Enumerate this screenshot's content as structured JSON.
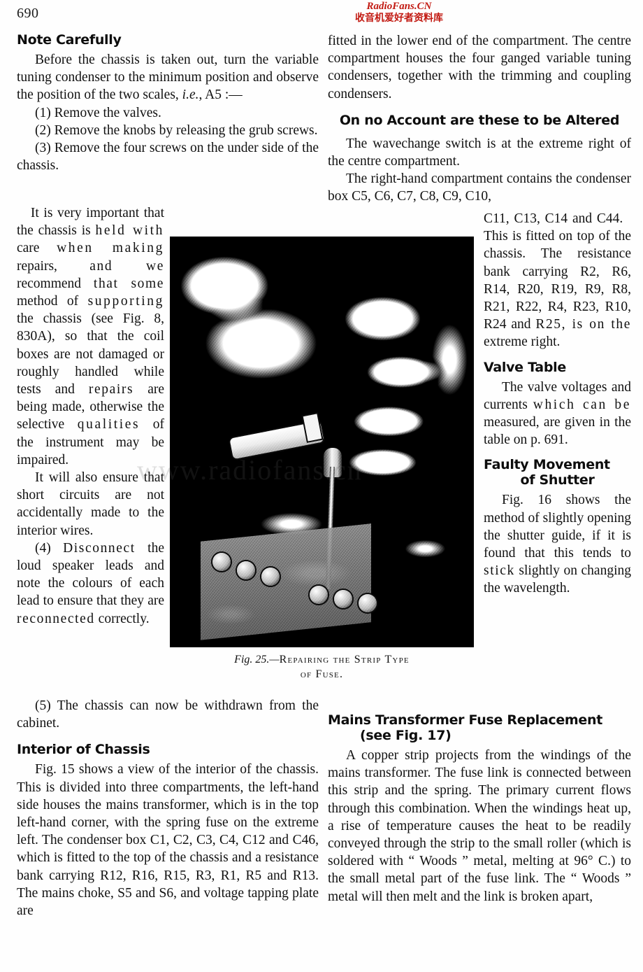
{
  "page": {
    "folio": "690"
  },
  "watermark": {
    "english": "RadioFans.CN",
    "chinese": "收音机爱好者资料库",
    "ghost": "www.radiofans.cn",
    "color": "#c21a12"
  },
  "left_column": {
    "heading_note": "Note Carefully",
    "para_before": "Before the chassis is taken out, turn the variable tuning condenser to the minimum position and observe the position of the two scales, i.e., A5 :—",
    "para_before_italic": "i.e.",
    "step_1": "(1) Remove the valves.",
    "step_2": "(2) Remove the knobs by releasing the grub screws.",
    "step_3": "(3) Remove the four screws on the under side of the chassis.",
    "para_important": "It is very important that the chassis is held with care when making repairs, and we recommend that some method of supporting the chassis (see Fig. 8, 830A), so that the coil boxes are not damaged or roughly handled while tests and repairs are being made, otherwise the selective qualities of the instrument may be impaired.",
    "para_ensure": "It will also ensure that short circuits are not accidentally made to the interior wires.",
    "step_4": "(4) Disconnect the loud speaker leads and note the colours of each lead to ensure that they are reconnected correctly.",
    "step_5": "(5) The chassis can now be withdrawn from the cabinet.",
    "heading_interior": "Interior of Chassis",
    "para_interior": "Fig. 15 shows a view of the interior of the chassis.  This is divided into three compartments, the left-hand side houses the mains transformer, which is in the top left-hand corner, with the spring fuse on the extreme left.  The condenser box C1, C2, C3, C4, C12 and C46, which is fitted to the top of the chassis and a resistance bank carrying R12, R16, R15, R3, R1, R5 and R13.  The mains choke, S5 and S6, and voltage tapping plate are"
  },
  "right_column": {
    "para_fitted": "fitted in the lower end of the compartment.  The centre compartment houses the four ganged variable tuning condensers, together with the trimming and coupling condensers.",
    "heading_altered": "On no Account are these to be Altered",
    "para_wavechange": "The wavechange switch is at the extreme right of the centre compartment.",
    "para_righthand_start": "The right-hand compartment contains the condenser box C5, C6, C7, C8, C9, C10,",
    "para_righthand_cont": "C11, C13, C14 and C44.   This is fitted on top of the chassis.  The resistance bank carrying R2, R6, R14, R20, R19, R9, R8, R21, R22, R4, R23, R10, R24 and R25, is on the extreme right.",
    "heading_valve_table": "Valve Table",
    "para_valve_table": "The valve voltages and currents which can be measured, are given in the table on p. 691.",
    "heading_faulty_line1": "Faulty   Movement",
    "heading_faulty_line2": "of Shutter",
    "para_faulty": "Fig. 16 shows the method of slightly opening the shutter guide, if it is found that this tends to stick slightly on changing the wavelength.",
    "heading_mains_line1": "Mains   Transformer   Fuse   Replacement",
    "heading_mains_line2": "(see Fig. 17)",
    "para_mains": "A copper strip projects from the windings of the mains transformer.  The fuse link is connected between this strip and the spring.  The primary current flows through this combination.  When the windings heat up, a rise of temperature causes the heat to be readily conveyed through the strip to the small roller (which is soldered with “ Woods ” metal, melting at 96° C.) to the small metal part of the fuse link.  The “ Woods ” metal will then melt and the link is broken apart,"
  },
  "figure": {
    "caption_number": "Fig. 25.—",
    "caption_line1": "Repairing the Strip Type",
    "caption_line2": "of Fuse.",
    "alt": "halftone photograph of two hands repairing the strip type of fuse on a radio chassis"
  }
}
